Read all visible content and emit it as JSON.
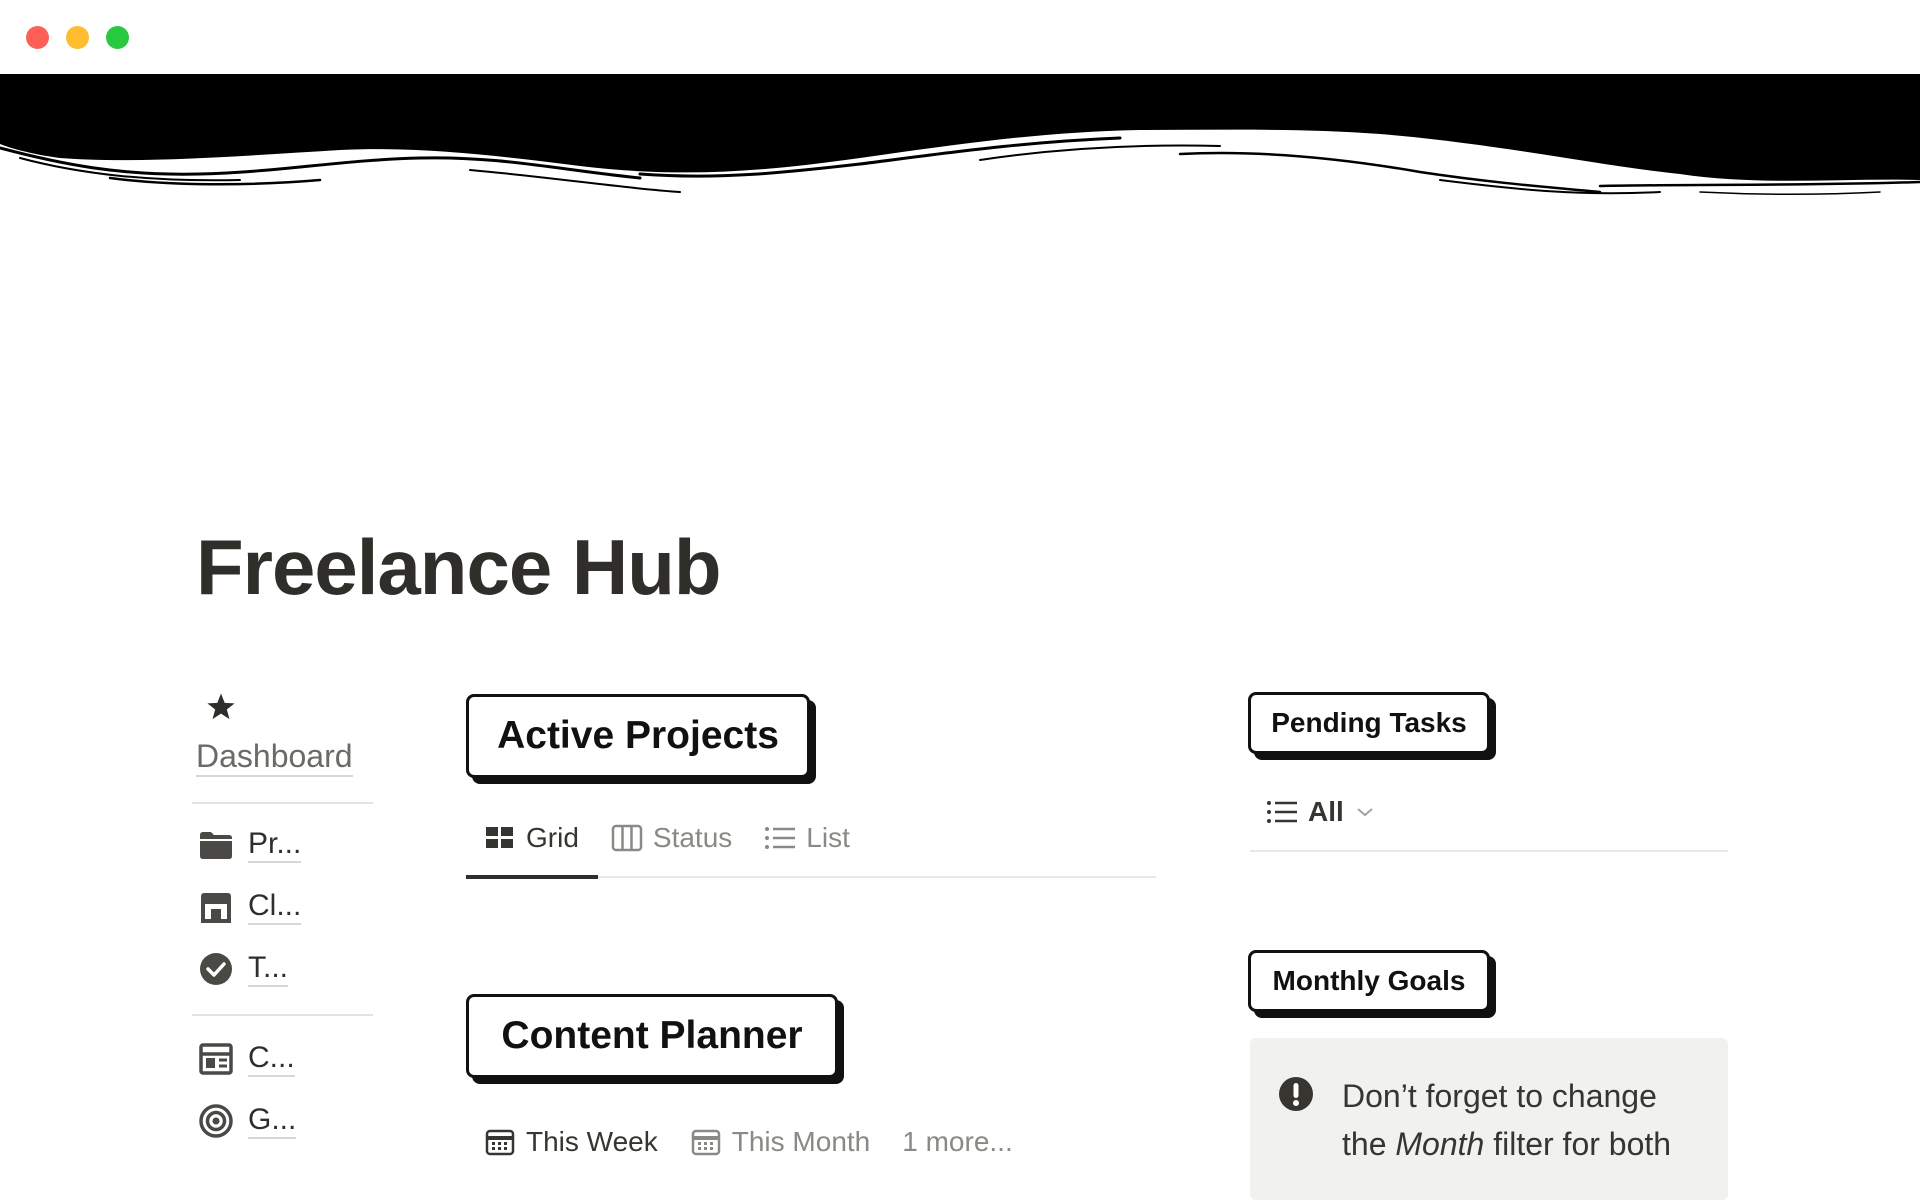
{
  "page": {
    "title": "Freelance Hub"
  },
  "sidebar": {
    "top_item": {
      "icon": "star-icon",
      "label": "Dashboard"
    },
    "group1": [
      {
        "icon": "folder-icon",
        "label": "Pr..."
      },
      {
        "icon": "store-icon",
        "label": "Cl..."
      },
      {
        "icon": "check-circle-icon",
        "label": "T..."
      }
    ],
    "group2": [
      {
        "icon": "layout-icon",
        "label": "C..."
      },
      {
        "icon": "target-icon",
        "label": "G..."
      }
    ]
  },
  "active_projects": {
    "title": "Active Projects",
    "views": [
      {
        "icon": "grid-icon",
        "label": "Grid"
      },
      {
        "icon": "columns-icon",
        "label": "Status"
      },
      {
        "icon": "list-icon",
        "label": "List"
      }
    ]
  },
  "content_planner": {
    "title": "Content Planner",
    "views": [
      {
        "icon": "calendar-icon",
        "label": "This Week"
      },
      {
        "icon": "calendar-icon",
        "label": "This Month"
      }
    ],
    "more_label": "1 more..."
  },
  "pending_tasks": {
    "title": "Pending Tasks",
    "view": {
      "icon": "list-icon",
      "label": "All"
    }
  },
  "monthly_goals": {
    "title": "Monthly Goals",
    "callout": {
      "icon": "exclamation-icon",
      "line1": "Don’t forget to change",
      "line2_pre": "the ",
      "line2_em": "Month",
      "line2_post": " filter for both"
    }
  }
}
